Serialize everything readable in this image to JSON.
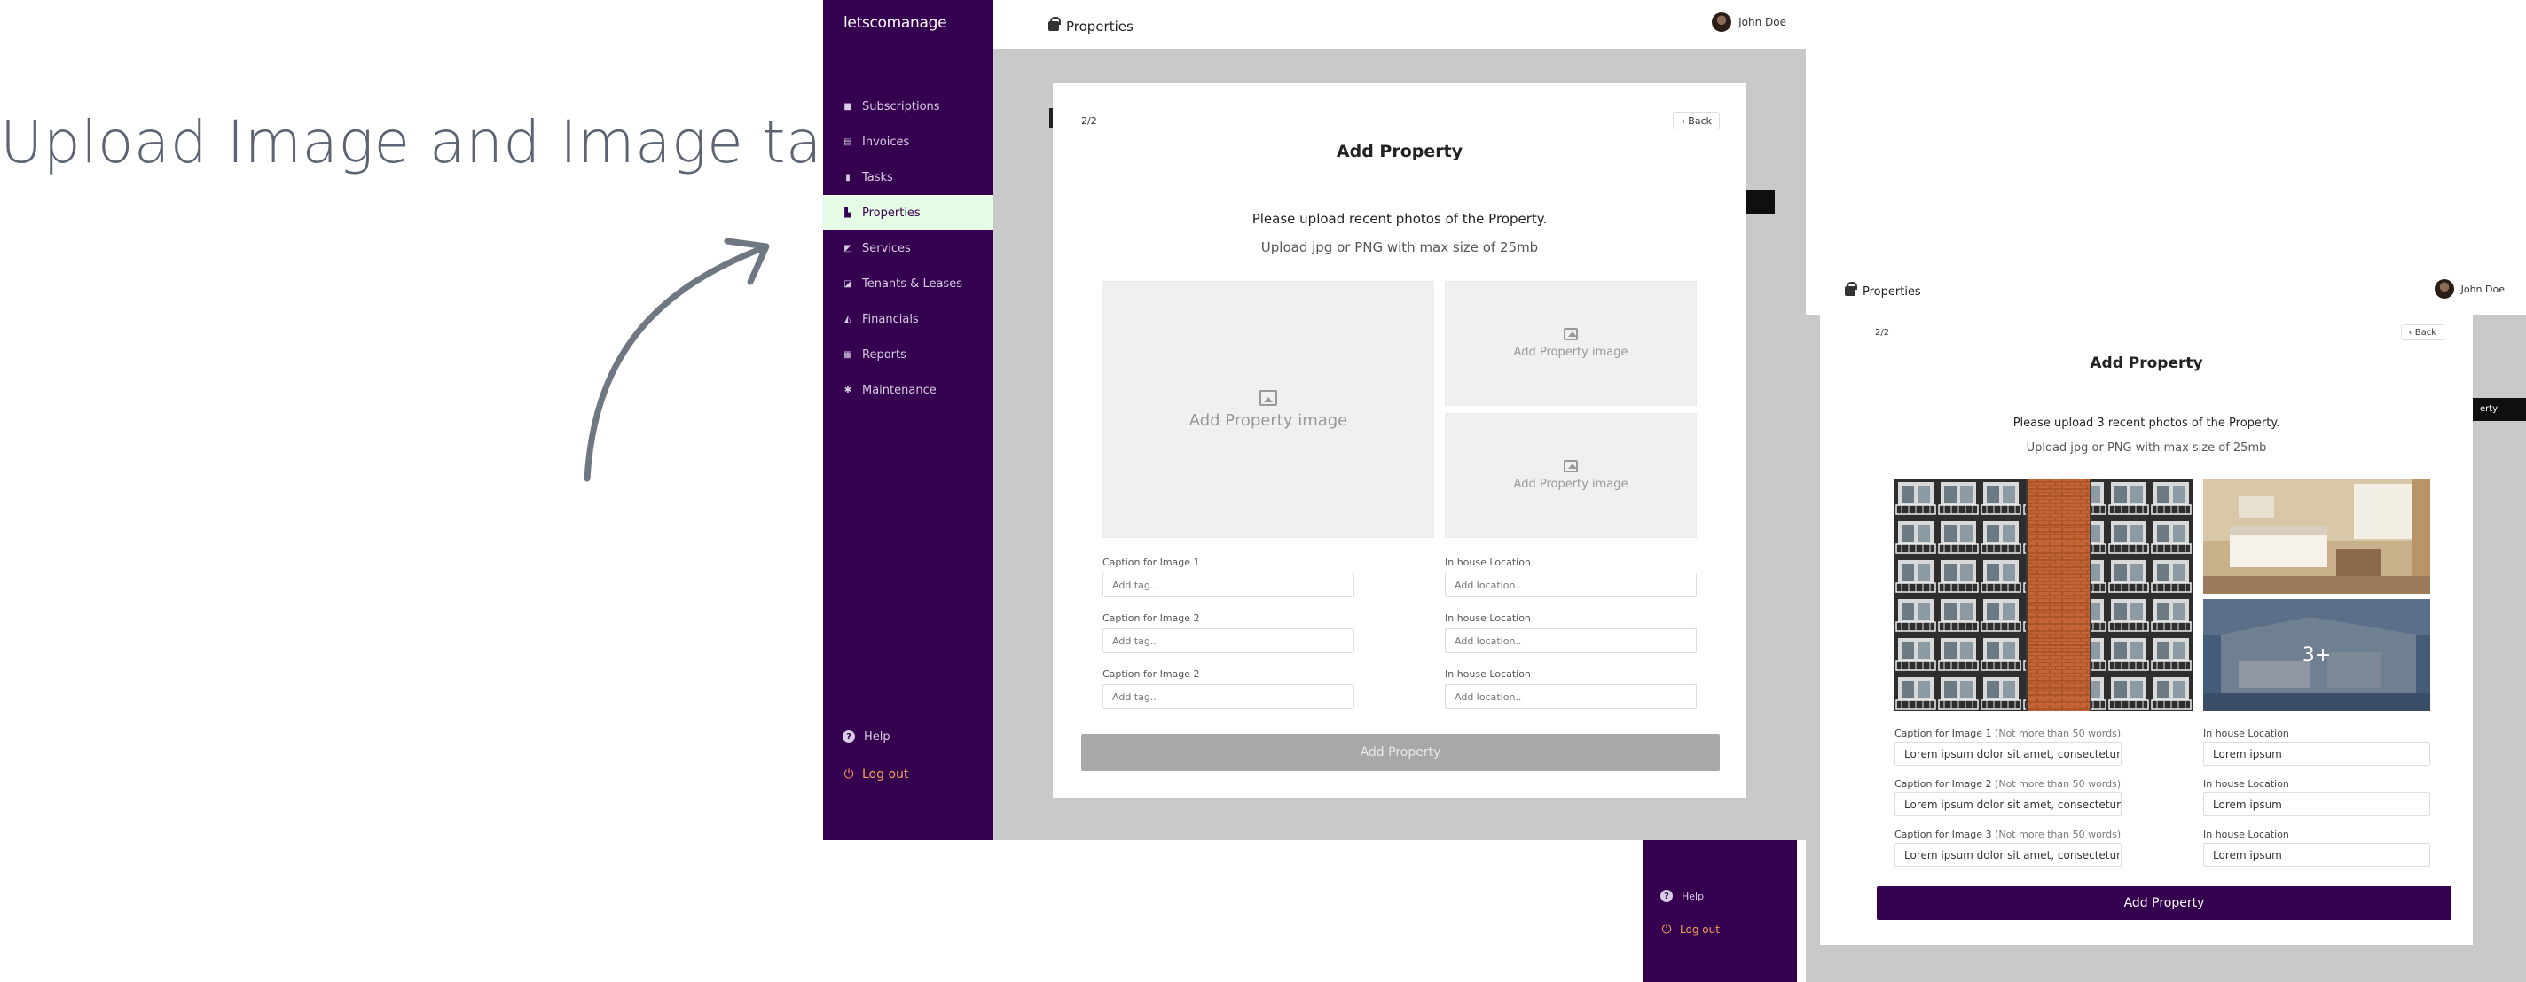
{
  "headline": "Upload Image and Image tags",
  "screen1": {
    "brand": "letscomanage",
    "header_title": "Properties",
    "user_name": "John Doe",
    "nav": [
      {
        "label": "Subscriptions",
        "icon": "lock-icon"
      },
      {
        "label": "Invoices",
        "icon": "invoice-icon"
      },
      {
        "label": "Tasks",
        "icon": "task-icon"
      },
      {
        "label": "Properties",
        "icon": "building-icon",
        "active": true
      },
      {
        "label": "Services",
        "icon": "services-icon"
      },
      {
        "label": "Tenants & Leases",
        "icon": "tenants-icon"
      },
      {
        "label": "Financials",
        "icon": "financials-icon"
      },
      {
        "label": "Reports",
        "icon": "reports-icon"
      },
      {
        "label": "Maintenance",
        "icon": "gear-icon"
      }
    ],
    "help": "Help",
    "logout": "Log out",
    "modal": {
      "step": "2/2",
      "back": "Back",
      "title": "Add Property",
      "instruction": "Please upload recent photos of the Property.",
      "hint": "Upload jpg or PNG with max size of 25mb",
      "upload_main": "Add Property image",
      "upload_small_1": "Add Property image",
      "upload_small_2": "Add Property image",
      "captions": [
        {
          "label": "Caption for Image 1",
          "placeholder": "Add tag..",
          "loc_label": "In house Location",
          "loc_placeholder": "Add location.."
        },
        {
          "label": "Caption for Image 2",
          "placeholder": "Add tag..",
          "loc_label": "In house Location",
          "loc_placeholder": "Add location.."
        },
        {
          "label": "Caption for Image 2",
          "placeholder": "Add tag..",
          "loc_label": "In house Location",
          "loc_placeholder": "Add location.."
        }
      ],
      "submit": "Add Property"
    }
  },
  "screen2": {
    "header_title": "Properties",
    "user_name": "John Doe",
    "help": "Help",
    "logout": "Log out",
    "bg_fragment": "erty",
    "modal": {
      "step": "2/2",
      "back": "Back",
      "title": "Add Property",
      "instruction": "Please upload 3 recent photos of the Property.",
      "hint": "Upload jpg or PNG with max size of 25mb",
      "more_badge": "3+",
      "captions": [
        {
          "label": "Caption for Image 1",
          "note": "(Not more than 50 words)",
          "value": "Lorem ipsum dolor sit amet, consectetur...",
          "loc_label": "In house Location",
          "loc_value": "Lorem ipsum"
        },
        {
          "label": "Caption for Image 2",
          "note": "(Not more than 50 words)",
          "value": "Lorem ipsum dolor sit amet, consectetur...",
          "loc_label": "In house Location",
          "loc_value": "Lorem ipsum"
        },
        {
          "label": "Caption for Image 3",
          "note": "(Not more than 50 words)",
          "value": "Lorem ipsum dolor sit amet, consectetur...",
          "loc_label": "In house Location",
          "loc_value": "Lorem ipsum"
        }
      ],
      "submit": "Add Property"
    }
  },
  "colors": {
    "sidebar": "#35004f",
    "active_nav": "#e6fbe6",
    "logout": "#f0a25a",
    "disabled_button": "#a8a8a8",
    "primary_button": "#35004f"
  }
}
